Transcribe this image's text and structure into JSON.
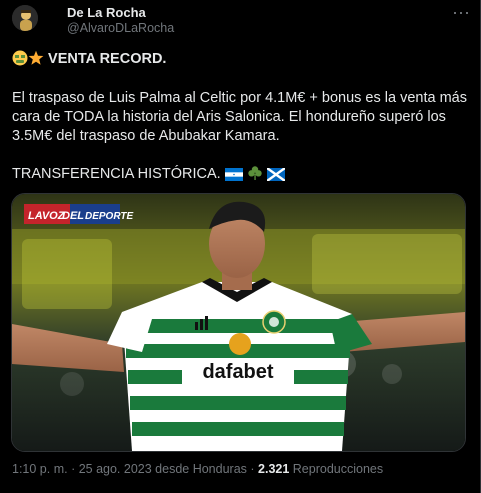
{
  "author": {
    "display_name": "De La Rocha",
    "handle": "@AlvaroDLaRocha",
    "more_icon": "more-horizontal-icon"
  },
  "tweet": {
    "headline": "VENTA RECORD.",
    "line1": "El traspaso de Luis Palma al Celtic por 4.1M€ + bonus es la venta más",
    "line2": "cara de TODA la historia del Aris Salonica. El hondureño superó los",
    "line3": "3.5M€ del traspaso de Abubakar Kamara.",
    "closing": "TRANSFERENCIA HISTÓRICA.",
    "icons": [
      "money-mouth-face-emoji",
      "star-emoji",
      "honduras-flag",
      "shamrock-emoji",
      "scotland-flag"
    ]
  },
  "media": {
    "watermark_left": "LAVOZ",
    "watermark_mid": "DEL",
    "watermark_right": "DEPORTE",
    "jersey_sponsor": "dafabet"
  },
  "meta": {
    "time": "1:10 p. m.",
    "sep1": " · ",
    "date": "25 ago. 2023 desde Honduras",
    "sep2": " · ",
    "views_count": "2.321",
    "views_label": " Reproducciones"
  },
  "colors": {
    "background": "#000000",
    "text": "#e7e9ea",
    "secondary": "#71767b",
    "celtic_green": "#1a7a3c"
  }
}
